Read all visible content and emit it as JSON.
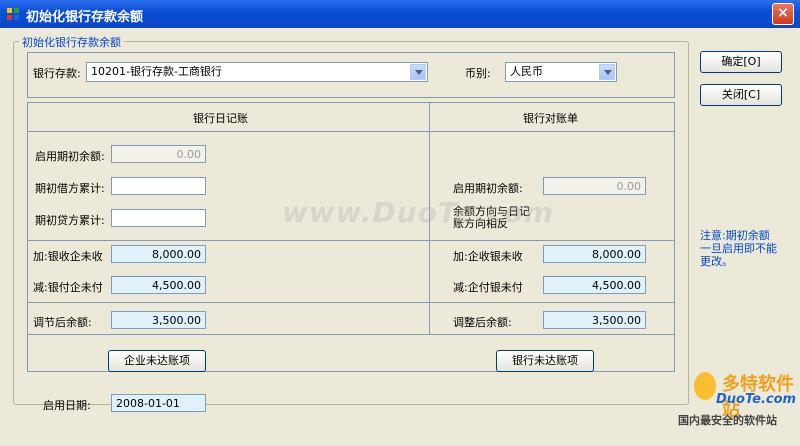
{
  "window": {
    "title": "初始化银行存款余额",
    "close_glyph": "×"
  },
  "group": {
    "legend": "初始化银行存款余额"
  },
  "top": {
    "account_label": "银行存款:",
    "account_value": "10201-银行存款-工商银行",
    "currency_label": "币别:",
    "currency_value": "人民币"
  },
  "left": {
    "header": "银行日记账",
    "opening_balance_label": "启用期初余额:",
    "opening_balance_value": "0.00",
    "debit_label": "期初借方累计:",
    "debit_value": "",
    "credit_label": "期初贷方累计:",
    "credit_value": "",
    "add_label": "加:银收企未收",
    "add_value": "8,000.00",
    "sub_label": "减:银付企未付",
    "sub_value": "4,500.00",
    "adjusted_label": "调节后余额:",
    "adjusted_value": "3,500.00",
    "button": "企业未达账项"
  },
  "right": {
    "header": "银行对账单",
    "opening_balance_label": "启用期初余额:",
    "opening_balance_value": "0.00",
    "direction_note": "余额方向与日记账方向相反",
    "add_label": "加:企收银未收",
    "add_value": "8,000.00",
    "sub_label": "减:企付银未付",
    "sub_value": "4,500.00",
    "adjusted_label": "调整后余额:",
    "adjusted_value": "3,500.00",
    "button": "银行未达账项"
  },
  "footer": {
    "start_date_label": "启用日期:",
    "start_date_value": "2008-01-01"
  },
  "buttons": {
    "ok": "确定[O]",
    "close": "关闭[C]"
  },
  "note": "注意:期初余额一旦启用即不能更改。",
  "watermark": {
    "main": "www.DuoTe.com",
    "brand": "多特软件站",
    "brand_url": "DuoTe.com",
    "brand_slogan": "国内最安全的软件站"
  }
}
